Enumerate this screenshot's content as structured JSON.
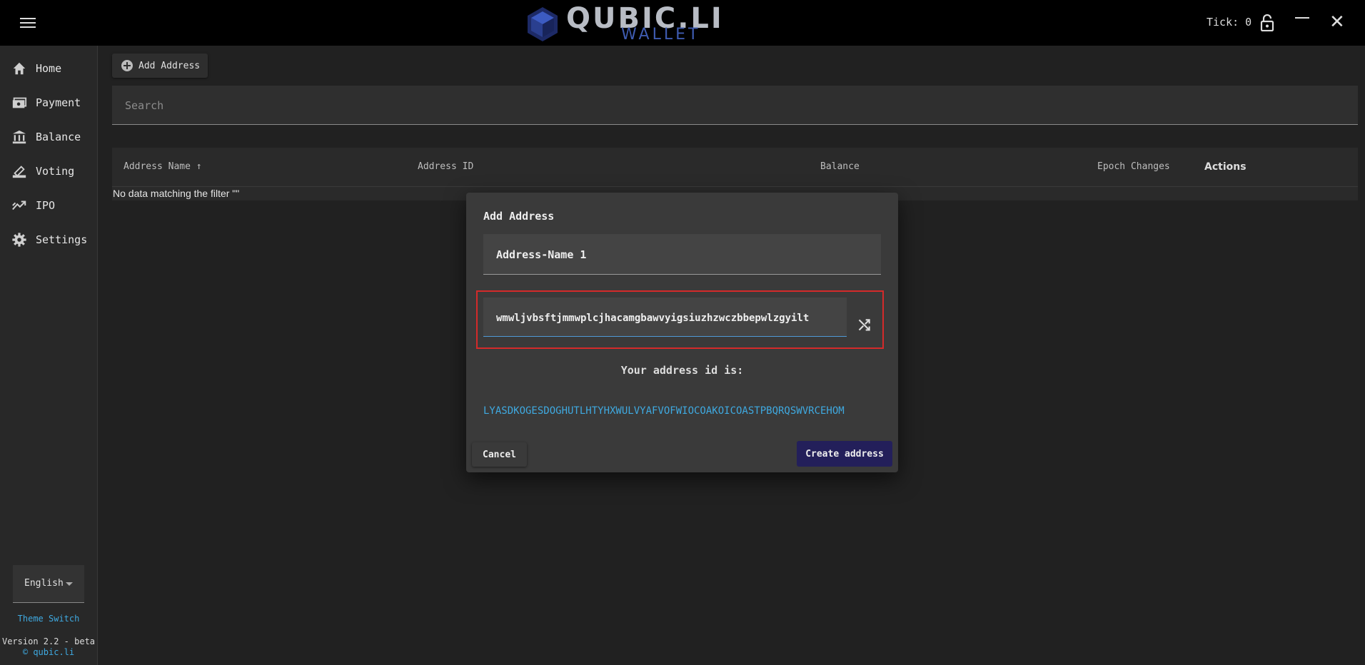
{
  "header": {
    "logo_title": "QUBIC.LI",
    "logo_subtitle": "WALLET",
    "tick_label": "Tick: 0"
  },
  "sidebar": {
    "items": [
      {
        "label": "Home",
        "icon": "home-icon"
      },
      {
        "label": "Payment",
        "icon": "payment-icon"
      },
      {
        "label": "Balance",
        "icon": "bank-icon"
      },
      {
        "label": "Voting",
        "icon": "vote-icon"
      },
      {
        "label": "IPO",
        "icon": "trending-icon"
      },
      {
        "label": "Settings",
        "icon": "gear-icon"
      }
    ],
    "language": "English",
    "theme_switch": "Theme Switch",
    "version": "Version 2.2 - beta",
    "site": "© qubic.li"
  },
  "toolbar": {
    "add_address_label": "Add Address"
  },
  "search": {
    "placeholder": "Search"
  },
  "table": {
    "columns": [
      "Address Name ↑",
      "Address ID",
      "Balance",
      "Epoch Changes",
      "Actions"
    ],
    "empty_text": "No data matching the filter \"\""
  },
  "dialog": {
    "title": "Add Address",
    "name_value": "Address-Name 1",
    "seed_value": "wmwljvbsftjmmwplcjhacamgbawvyigsiuzhzwczbbepwlzgyilt",
    "address_label": "Your address id is:",
    "address_id": "LYASDKOGESDOGHUTLHTYHXWULVYAFVOFWIOCOAKOICOASTPBQRQSWVRCEHOM",
    "cancel_label": "Cancel",
    "create_label": "Create address"
  },
  "colors": {
    "accent": "#3fa9e0",
    "primary_button": "#231f5a",
    "highlight_border": "#d42a2a"
  }
}
